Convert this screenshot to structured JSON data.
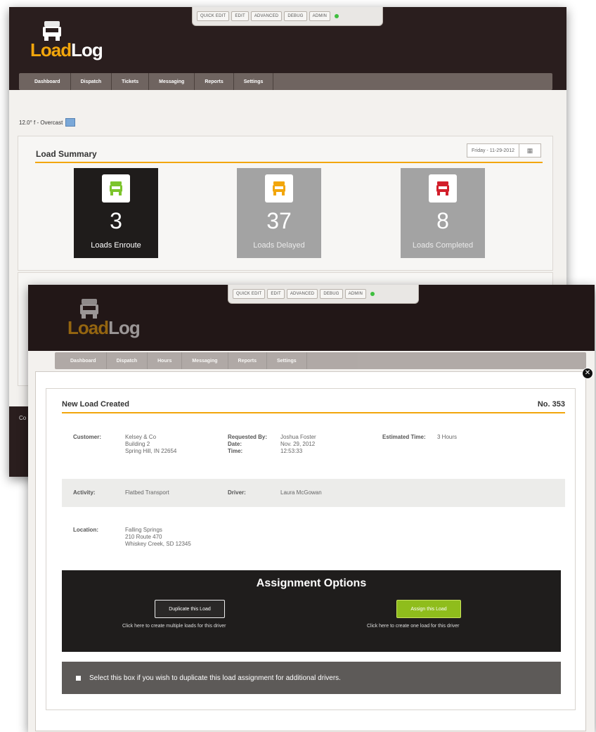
{
  "toolbar": {
    "buttons": [
      "QUICK EDIT",
      "EDIT",
      "ADVANCED",
      "DEBUG",
      "ADMIN"
    ]
  },
  "brand": {
    "logo_a": "Load",
    "logo_b": "Log",
    "accent": "#f2a60c",
    "dark": "#2a1e1e"
  },
  "nav": {
    "items": [
      "Dashboard",
      "Dispatch",
      "Tickets",
      "Messaging",
      "Reports",
      "Settings"
    ]
  },
  "nav2": {
    "items": [
      "Dashboard",
      "Dispatch",
      "Hours",
      "Messaging",
      "Reports",
      "Settings"
    ]
  },
  "weather": {
    "text": "12.0° f - Overcast",
    "icon": "weather-icon"
  },
  "summary": {
    "title": "Load Summary",
    "date": "Friday - 11-29-2012",
    "calendar_icon": "calendar-icon",
    "tiles": [
      {
        "count": "3",
        "label": "Loads Enroute",
        "color": "#7cc42c",
        "style": "dark"
      },
      {
        "count": "37",
        "label": "Loads Delayed",
        "color": "#f2a60c",
        "style": "grey"
      },
      {
        "count": "8",
        "label": "Loads Completed",
        "color": "#d21f2b",
        "style": "grey"
      }
    ]
  },
  "footer": {
    "copy": "Co"
  },
  "modal": {
    "title": "New Load Created",
    "number": "No. 353",
    "customer_label": "Customer:",
    "customer": [
      "Kelsey & Co",
      "Building 2",
      "Spring Hill, IN 22654"
    ],
    "requested_label": "Requested By:",
    "date_label": "Date:",
    "time_label": "Time:",
    "requested_by": "Joshua Foster",
    "date": "Nov. 29, 2012",
    "time": "12:53:33",
    "est_label": "Estimated Time:",
    "est_value": "3 Hours",
    "activity_label": "Activity:",
    "activity": "Flatbed Transport",
    "driver_label": "Driver:",
    "driver": "Laura McGowan",
    "location_label": "Location:",
    "location": [
      "Falling Springs",
      "210 Route 470",
      "Whiskey Creek, SD 12345"
    ],
    "assign_title": "Assignment Options",
    "dup_btn": "Duplicate this Load",
    "dup_hint": "Click here to create multiple loads for this driver",
    "assign_btn": "Assign this Load",
    "assign_hint": "Click here to create one load for this driver",
    "check_text": "Select this box if you wish to duplicate this load assignment for additional drivers."
  }
}
